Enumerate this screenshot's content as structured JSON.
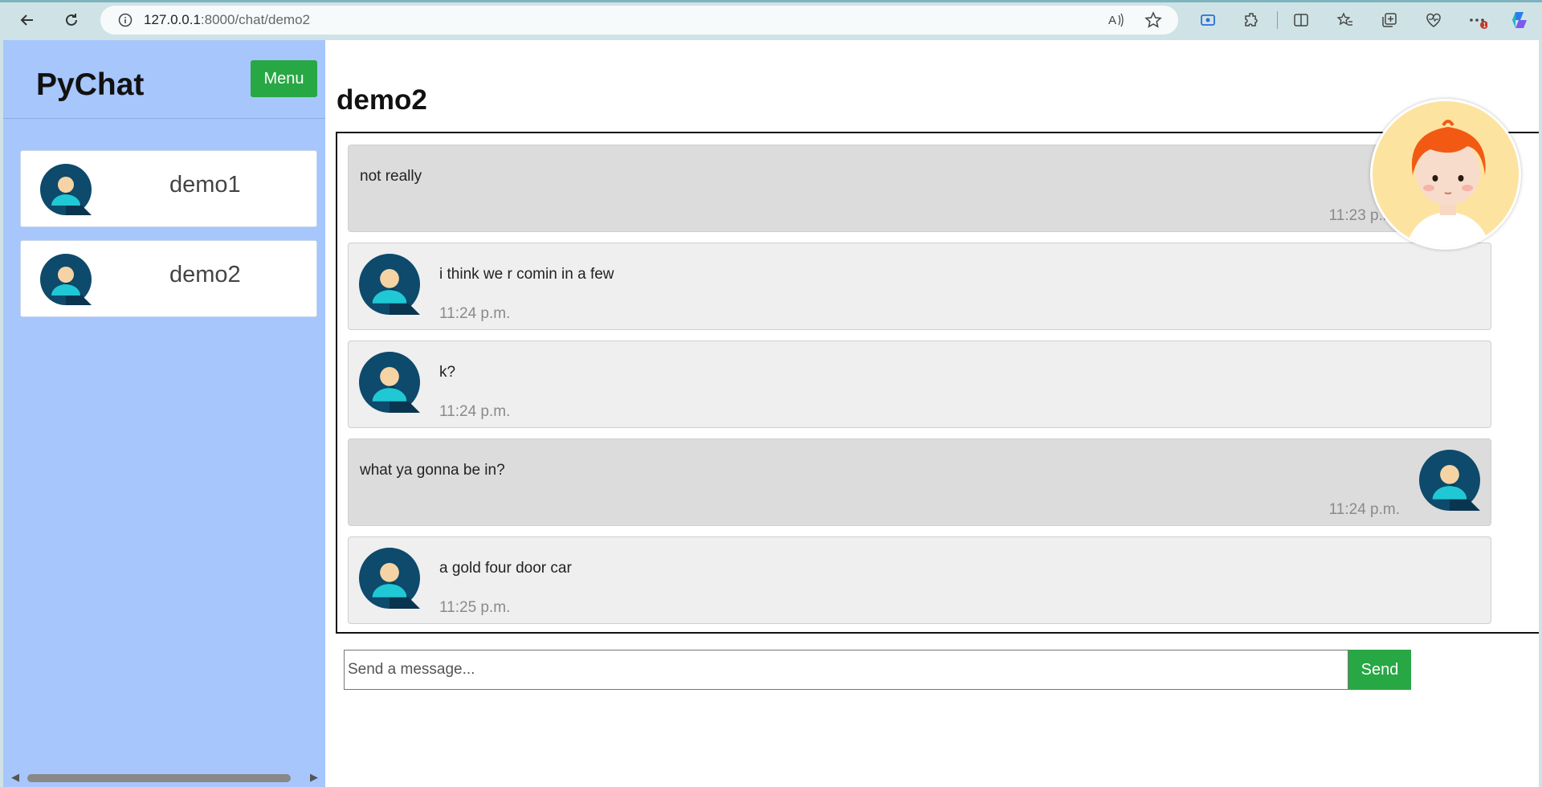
{
  "browser": {
    "url_host": "127.0.0.1",
    "url_path": ":8000/chat/demo2"
  },
  "sidebar": {
    "brand": "PyChat",
    "menu_label": "Menu",
    "contacts": [
      {
        "name": "demo1"
      },
      {
        "name": "demo2"
      }
    ]
  },
  "chat": {
    "title": "demo2",
    "messages": [
      {
        "direction": "sent",
        "text": "not really",
        "time": "11:23 p.m."
      },
      {
        "direction": "received",
        "text": "i think we r comin in a few",
        "time": "11:24 p.m."
      },
      {
        "direction": "received",
        "text": "k?",
        "time": "11:24 p.m."
      },
      {
        "direction": "sent",
        "text": "what ya gonna be in?",
        "time": "11:24 p.m."
      },
      {
        "direction": "received",
        "text": "a gold four door car",
        "time": "11:25 p.m."
      }
    ],
    "input_placeholder": "Send a message...",
    "send_label": "Send"
  },
  "colors": {
    "accent_green": "#28a745",
    "sidebar_bg": "#a6c6fc"
  }
}
